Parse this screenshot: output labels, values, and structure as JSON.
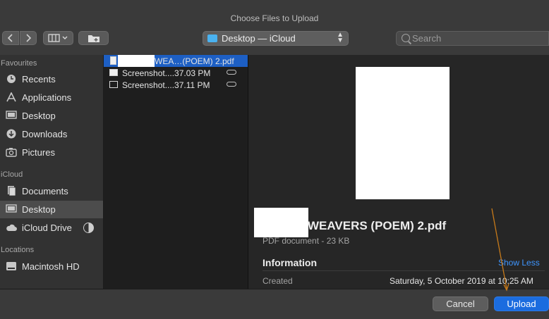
{
  "window": {
    "title": "Choose Files to Upload"
  },
  "toolbar": {
    "location": "Desktop — iCloud",
    "search_placeholder": "Search"
  },
  "sidebar": {
    "sections": [
      {
        "title": "Favourites",
        "items": [
          {
            "label": "Recents",
            "icon": "clock-icon"
          },
          {
            "label": "Applications",
            "icon": "applications-icon"
          },
          {
            "label": "Desktop",
            "icon": "desktop-icon"
          },
          {
            "label": "Downloads",
            "icon": "download-icon"
          },
          {
            "label": "Pictures",
            "icon": "camera-icon"
          }
        ]
      },
      {
        "title": "iCloud",
        "items": [
          {
            "label": "Documents",
            "icon": "documents-icon"
          },
          {
            "label": "Desktop",
            "icon": "desktop-icon",
            "selected": true
          },
          {
            "label": "iCloud Drive",
            "icon": "cloud-icon"
          }
        ]
      },
      {
        "title": "Locations",
        "items": [
          {
            "label": "Macintosh HD",
            "icon": "hard-drive-icon"
          }
        ]
      }
    ]
  },
  "files": [
    {
      "name": "WEA…(POEM) 2.pdf",
      "icon": "pdf-file-icon",
      "selected": true
    },
    {
      "name": "Screenshot....37.03 PM",
      "icon": "screenshot-file-icon",
      "cloud": true
    },
    {
      "name": "Screenshot....37.11 PM",
      "icon": "screenshot-file-icon",
      "cloud": true
    }
  ],
  "preview": {
    "name": "WEAVERS (POEM) 2.pdf",
    "kind": "PDF document - 23 KB",
    "info_title": "Information",
    "toggle": "Show Less",
    "created_label": "Created",
    "created_value": "Saturday, 5 October 2019 at 10:25 AM"
  },
  "buttons": {
    "cancel": "Cancel",
    "upload": "Upload"
  },
  "colors": {
    "accent": "#1b6cdf",
    "selection": "#1d5fc4",
    "annotation_arrow": "#c77a1a"
  }
}
